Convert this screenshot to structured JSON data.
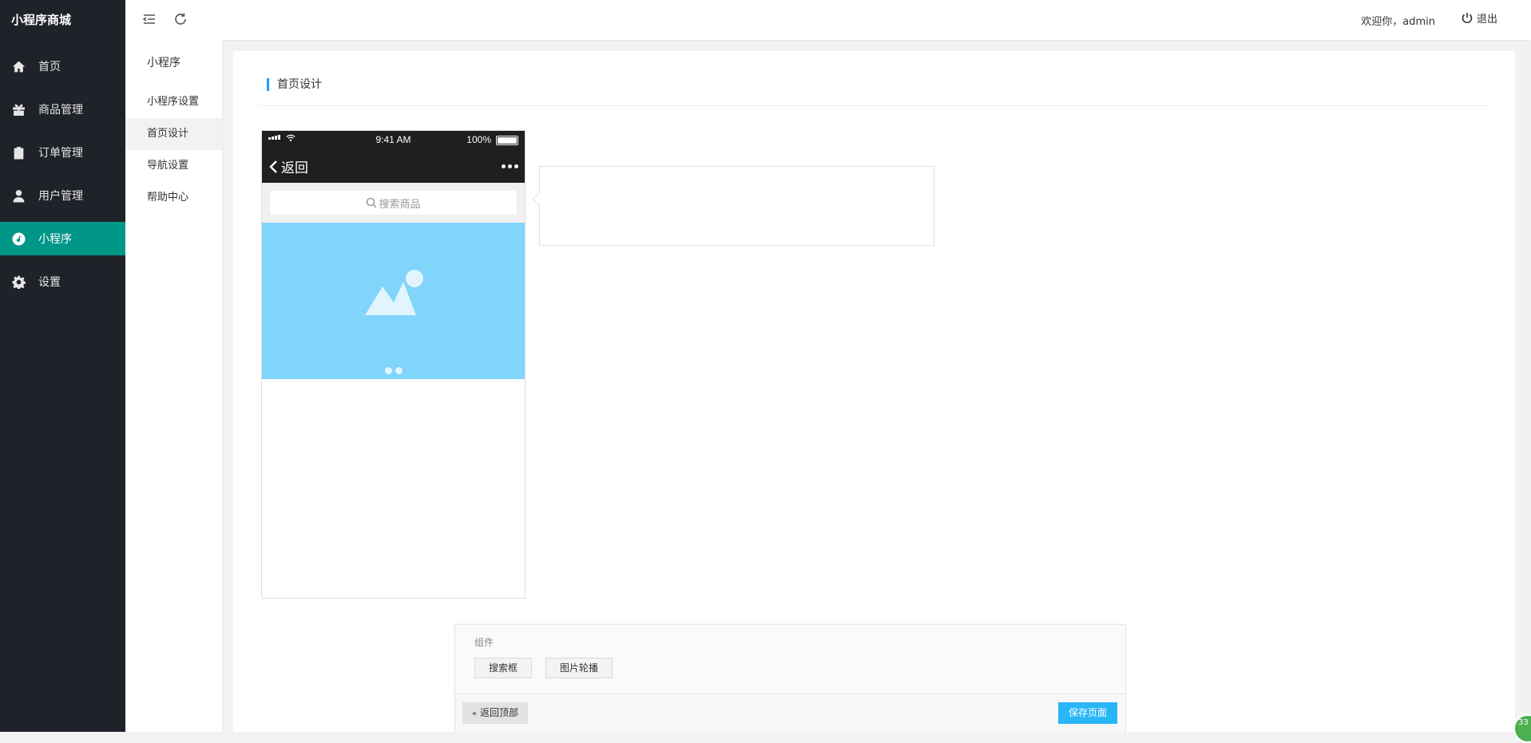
{
  "app": {
    "brand": "小程序商城"
  },
  "sidebar": {
    "items": [
      {
        "label": "首页",
        "icon": "home-icon"
      },
      {
        "label": "商品管理",
        "icon": "gift-icon"
      },
      {
        "label": "订单管理",
        "icon": "clipboard-icon"
      },
      {
        "label": "用户管理",
        "icon": "user-icon"
      },
      {
        "label": "小程序",
        "icon": "miniprogram-icon",
        "active": true
      },
      {
        "label": "设置",
        "icon": "gear-icon"
      }
    ]
  },
  "subnav": {
    "title": "小程序",
    "items": [
      {
        "label": "小程序设置"
      },
      {
        "label": "首页设计",
        "active": true
      },
      {
        "label": "导航设置"
      },
      {
        "label": "帮助中心"
      }
    ]
  },
  "header": {
    "welcome": "欢迎你，admin",
    "logout": "退出"
  },
  "main": {
    "section_title": "首页设计"
  },
  "phone": {
    "time": "9:41 AM",
    "battery": "100%",
    "back_label": "返回",
    "search_placeholder": "搜索商品"
  },
  "components": {
    "label": "组件",
    "buttons": [
      "搜索框",
      "图片轮播"
    ],
    "back_top": "返回顶部",
    "save": "保存页面"
  },
  "colors": {
    "accent": "#009688",
    "primary": "#1e9fff",
    "save": "#29b6f6",
    "sidebar_bg": "#20222a",
    "banner": "#81d4fa"
  },
  "corner_badge": "33"
}
